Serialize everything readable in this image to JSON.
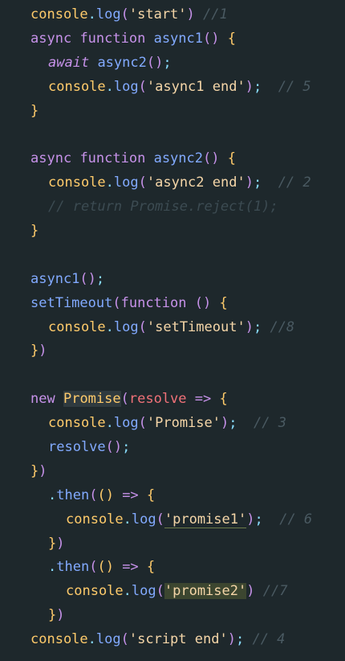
{
  "code": {
    "lines": [
      {
        "id": "l1"
      },
      {
        "id": "l2"
      }
    ],
    "tokens": {
      "console": "console",
      "log": "log",
      "dot": ".",
      "start_str": "'start'",
      "c1": "//1",
      "async": "async",
      "function": "function",
      "async1": "async1",
      "async2": "async2",
      "await": "await",
      "async1_end_str": "'async1 end'",
      "c5": "// 5",
      "async2_end_str": "'async2 end'",
      "c2": "// 2",
      "return_comment": "// return Promise.reject(1);",
      "setTimeout": "setTimeout",
      "setTimeout_str": "'setTimeout'",
      "c8": "//8",
      "new": "new",
      "Promise": "Promise",
      "resolve": "resolve",
      "promise_str": "'Promise'",
      "c3": "// 3",
      "then": "then",
      "promise1_str": "'promise1'",
      "c6": "// 6",
      "promise2_str": "'promise2'",
      "c7": "//7",
      "script_end_str": "'script end'",
      "c4": "// 4"
    }
  },
  "colors": {
    "background": "#1e282c",
    "keyword": "#c792ea",
    "function": "#82aaff",
    "string": "#f5d6a8",
    "comment": "#4a5a62",
    "brace": "#ffcb6b"
  }
}
